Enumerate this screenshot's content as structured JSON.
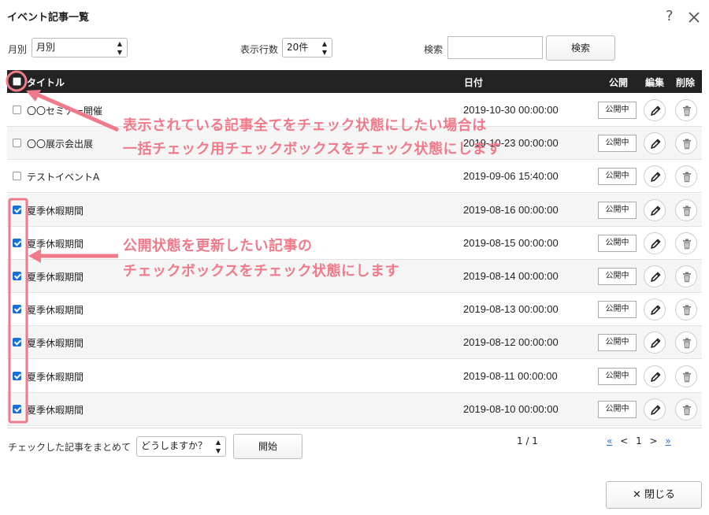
{
  "dialog": {
    "title": "イベント記事一覧",
    "help": "?",
    "close_icon": "close-icon"
  },
  "filters": {
    "month_label": "月別",
    "month_value": "月別",
    "rows_label": "表示行数",
    "rows_value": "20件",
    "search_label": "検索",
    "search_value": "",
    "search_button": "検索"
  },
  "table": {
    "headers": {
      "title": "タイトル",
      "date": "日付",
      "publish": "公開",
      "edit": "編集",
      "delete": "削除"
    },
    "rows": [
      {
        "title": "〇〇セミナー開催",
        "date": "2019-10-30 00:00:00",
        "status": "公開中",
        "checked": false
      },
      {
        "title": "〇〇展示会出展",
        "date": "2019-10-23 00:00:00",
        "status": "公開中",
        "checked": false
      },
      {
        "title": "テストイベントA",
        "date": "2019-09-06 15:40:00",
        "status": "公開中",
        "checked": false
      },
      {
        "title": "夏季休暇期間",
        "date": "2019-08-16 00:00:00",
        "status": "公開中",
        "checked": true
      },
      {
        "title": "夏季休暇期間",
        "date": "2019-08-15 00:00:00",
        "status": "公開中",
        "checked": true
      },
      {
        "title": "夏季休暇期間",
        "date": "2019-08-14 00:00:00",
        "status": "公開中",
        "checked": true
      },
      {
        "title": "夏季休暇期間",
        "date": "2019-08-13 00:00:00",
        "status": "公開中",
        "checked": true
      },
      {
        "title": "夏季休暇期間",
        "date": "2019-08-12 00:00:00",
        "status": "公開中",
        "checked": true
      },
      {
        "title": "夏季休暇期間",
        "date": "2019-08-11 00:00:00",
        "status": "公開中",
        "checked": true
      },
      {
        "title": "夏季休暇期間",
        "date": "2019-08-10 00:00:00",
        "status": "公開中",
        "checked": true
      }
    ]
  },
  "bulk": {
    "label": "チェックした記事をまとめて",
    "select_value": "どうしますか？",
    "start_button": "開始"
  },
  "pagination": {
    "count": "1 / 1",
    "first": "«",
    "prev": "<",
    "current": "1",
    "next": ">",
    "last": "»"
  },
  "footer": {
    "close_button": "✕ 閉じる"
  },
  "annotations": {
    "select_all_line1": "表示されている記事全てをチェック状態にしたい場合は",
    "select_all_line2": "一括チェック用チェックボックスをチェック状態にします",
    "select_rows_line1": "公開状態を更新したい記事の",
    "select_rows_line2": "チェックボックスをチェック状態にします",
    "color": "#f07a8a"
  },
  "colors": {
    "header_bg": "#232323",
    "checkbox_on": "#1a6fd6",
    "link": "#2a6fd6"
  }
}
